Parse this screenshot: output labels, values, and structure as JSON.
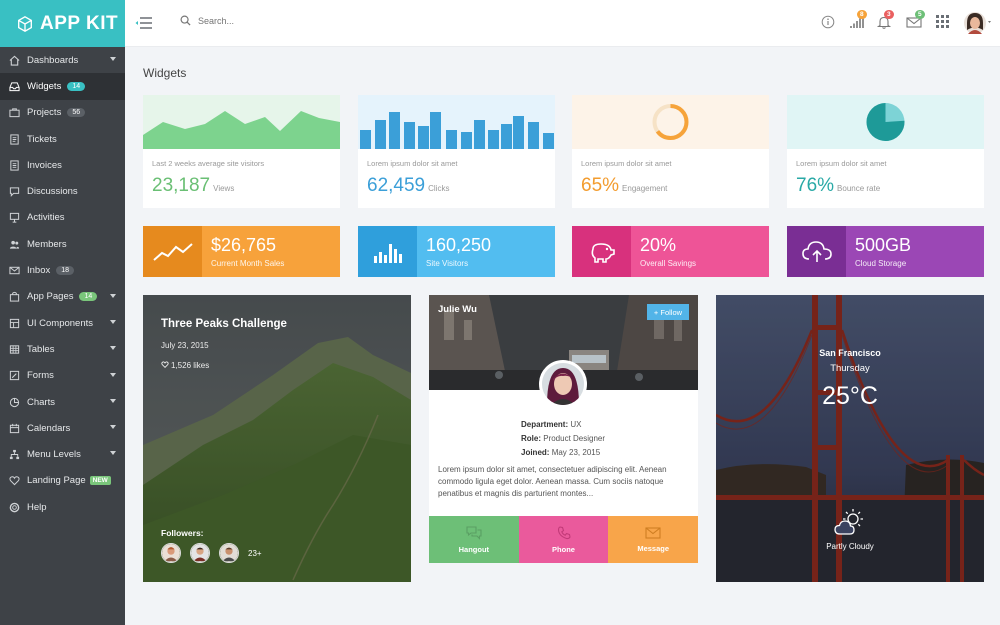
{
  "brand": {
    "name": "APP KIT"
  },
  "search": {
    "placeholder": "Search..."
  },
  "header": {
    "badges": {
      "activity": "8",
      "notifications": "3",
      "messages": "5"
    }
  },
  "sidebar": {
    "items": [
      {
        "label": "Dashboards",
        "icon": "home-icon"
      },
      {
        "label": "Widgets",
        "badge": "14",
        "icon": "inbox-tray-icon"
      },
      {
        "label": "Projects",
        "badge": "56",
        "icon": "briefcase-icon"
      },
      {
        "label": "Tickets",
        "icon": "ticket-icon"
      },
      {
        "label": "Invoices",
        "icon": "invoice-icon"
      },
      {
        "label": "Discussions",
        "icon": "chat-icon"
      },
      {
        "label": "Activities",
        "icon": "presentation-icon"
      },
      {
        "label": "Members",
        "icon": "users-icon"
      },
      {
        "label": "Inbox",
        "badge": "18",
        "icon": "mail-icon"
      },
      {
        "label": "App Pages",
        "badge": "14",
        "icon": "bag-icon"
      },
      {
        "label": "UI Components",
        "icon": "components-icon"
      },
      {
        "label": "Tables",
        "icon": "table-icon"
      },
      {
        "label": "Forms",
        "icon": "form-icon"
      },
      {
        "label": "Charts",
        "icon": "pie-chart-icon"
      },
      {
        "label": "Calendars",
        "icon": "calendar-icon"
      },
      {
        "label": "Menu Levels",
        "icon": "sitemap-icon"
      },
      {
        "label": "Landing Page",
        "tag": "NEW",
        "icon": "heart-icon"
      },
      {
        "label": "Help",
        "icon": "lifebuoy-icon"
      }
    ]
  },
  "page": {
    "title": "Widgets"
  },
  "widgets": [
    {
      "subtitle": "Last 2 weeks average site visitors",
      "value": "23,187",
      "unit": "Views",
      "color": "#7dd38e"
    },
    {
      "subtitle": "Lorem ipsum dolor sit amet",
      "value": "62,459",
      "unit": "Clicks",
      "color": "#3b9fd8"
    },
    {
      "subtitle": "Lorem ipsum dolor sit amet",
      "value": "65%",
      "unit": "Engagement",
      "color": "#f6a33a",
      "progress": 0.65
    },
    {
      "subtitle": "Lorem ipsum dolor sit amet",
      "value": "76%",
      "unit": "Bounce rate",
      "color": "#29a9a6",
      "progress": 0.76
    }
  ],
  "stats": [
    {
      "value": "$26,765",
      "label": "Current Month Sales",
      "color": "#f7a23b",
      "icon": "line-chart-icon"
    },
    {
      "value": "160,250",
      "label": "Site Visitors",
      "color": "#3eb1e8",
      "icon": "bar-chart-icon"
    },
    {
      "value": "20%",
      "label": "Overall Savings",
      "color": "#ea4b93",
      "icon": "piggy-bank-icon"
    },
    {
      "value": "500GB",
      "label": "Cloud Storage",
      "color": "#8e41a9",
      "icon": "cloud-upload-icon"
    }
  ],
  "post": {
    "title": "Three Peaks Challenge",
    "date": "July 23, 2015",
    "likes": "1,526 likes",
    "followers_label": "Followers:",
    "more": "23+"
  },
  "profile": {
    "name": "Julie Wu",
    "follow": "+ Follow",
    "department_label": "Department:",
    "department": "UX",
    "role_label": "Role:",
    "role": "Product Designer",
    "joined_label": "Joined:",
    "joined": "May 23, 2015",
    "bio": "Lorem ipsum dolor sit amet, consectetuer adipiscing elit. Aenean commodo ligula eget dolor. Aenean massa. Cum sociis natoque penatibus et magnis dis parturient montes...",
    "actions": [
      {
        "label": "Hangout",
        "color": "#6dbf77",
        "icon": "hangout-icon"
      },
      {
        "label": "Phone",
        "color": "#ea5a9c",
        "icon": "phone-icon"
      },
      {
        "label": "Message",
        "color": "#f8a54a",
        "icon": "envelope-icon"
      }
    ]
  },
  "weather": {
    "city": "San Francisco",
    "day": "Thursday",
    "temp": "25°C",
    "condition": "Partly Cloudy"
  }
}
